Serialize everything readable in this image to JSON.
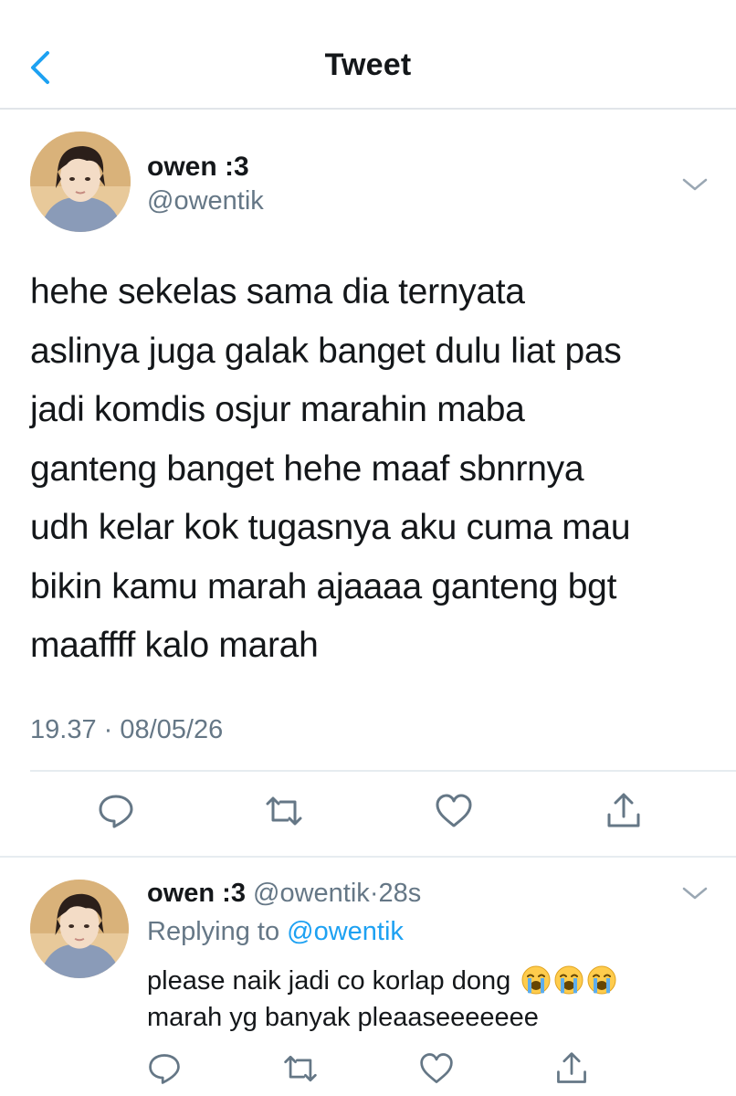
{
  "header": {
    "title": "Tweet",
    "back_icon": "chevron-left-icon",
    "accent_color": "#1da1f2"
  },
  "tweet": {
    "author_name": "owen :3",
    "author_handle": "@owentik",
    "text": "hehe sekelas sama dia ternyata\naslinya juga galak banget dulu liat pas\njadi komdis osjur marahin maba\nganteng banget hehe maaf sbnrnya\nudh kelar kok tugasnya aku cuma mau\nbikin kamu marah ajaaaa ganteng bgt\nmaaffff kalo marah",
    "timestamp": "19.37 · 08/05/26",
    "actions": [
      "reply-icon",
      "retweet-icon",
      "like-icon",
      "share-icon"
    ]
  },
  "reply": {
    "author_name": "owen :3",
    "author_handle": "@owentik",
    "dot": "·",
    "time": "28s",
    "replying_prefix": "Replying to",
    "replying_to": "@owentik",
    "line1": "please naik jadi co korlap dong",
    "line2": "marah yg banyak pleaaseeeeeee",
    "emojis": [
      "loudly-crying-face-emoji",
      "loudly-crying-face-emoji",
      "loudly-crying-face-emoji"
    ],
    "actions": [
      "reply-icon",
      "retweet-icon",
      "like-icon",
      "share-icon"
    ]
  }
}
